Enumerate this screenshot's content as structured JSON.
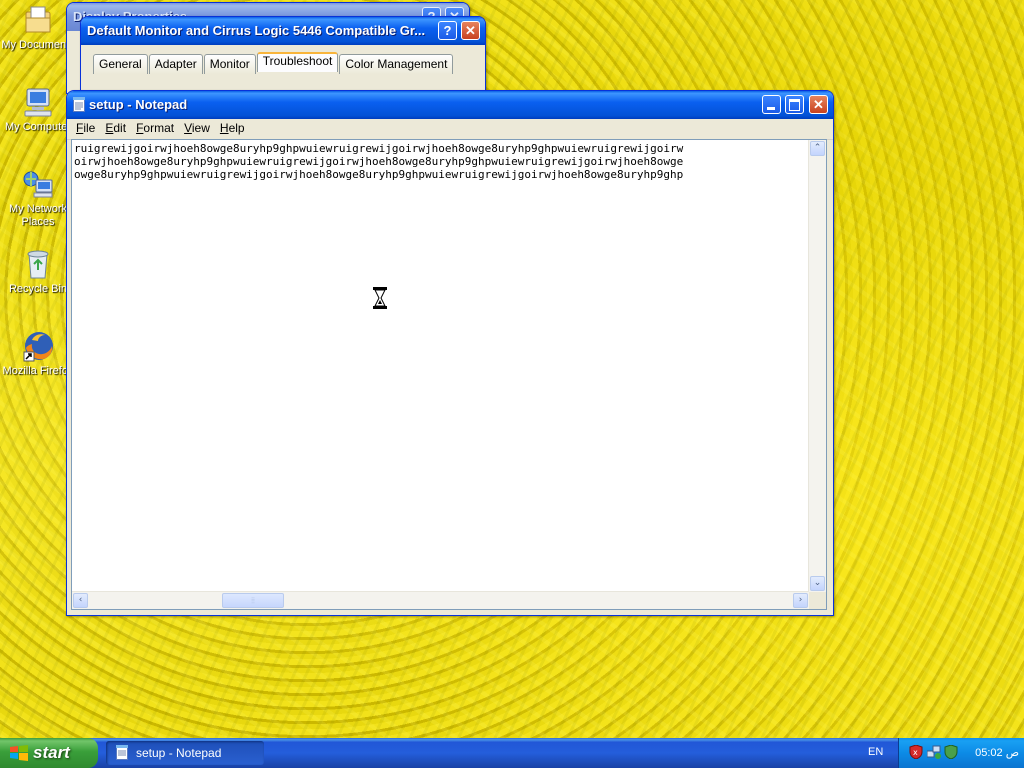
{
  "desktop": {
    "icons": [
      {
        "label": "My Documents",
        "icon": "folder-documents-icon"
      },
      {
        "label": "My Computer",
        "icon": "computer-icon"
      },
      {
        "label": "My Network Places",
        "icon": "network-places-icon"
      },
      {
        "label": "Recycle Bin",
        "icon": "recycle-bin-icon"
      },
      {
        "label": "Mozilla Firefox",
        "icon": "firefox-icon"
      }
    ]
  },
  "display_properties": {
    "title": "Display Properties"
  },
  "monitor_properties": {
    "title": "Default Monitor and Cirrus Logic 5446 Compatible Gr...",
    "tabs": [
      "General",
      "Adapter",
      "Monitor",
      "Troubleshoot",
      "Color Management"
    ],
    "active_tab": "Troubleshoot"
  },
  "notepad": {
    "title": "setup - Notepad",
    "menu": [
      "File",
      "Edit",
      "Format",
      "View",
      "Help"
    ],
    "text_lines": [
      "ruigrewijgoirwjhoeh8owge8uryhp9ghpwuiewruigrewijgoirwjhoeh8owge8uryhp9ghpwuiewruigrewijgoirw",
      "oirwjhoeh8owge8uryhp9ghpwuiewruigrewijgoirwjhoeh8owge8uryhp9ghpwuiewruigrewijgoirwjhoeh8owge",
      "owge8uryhp9ghpwuiewruigrewijgoirwjhoeh8owge8uryhp9ghpwuiewruigrewijgoirwjhoeh8owge8uryhp9ghp"
    ]
  },
  "taskbar": {
    "start_label": "start",
    "tasks": [
      {
        "label": "setup - Notepad",
        "icon": "notepad-icon"
      }
    ],
    "language": "EN",
    "clock": "05:02 ص"
  },
  "colors": {
    "title_active": "#0a60f0",
    "taskbar": "#245edb",
    "start_green": "#3a9f3a",
    "tray": "#0c8be6"
  }
}
